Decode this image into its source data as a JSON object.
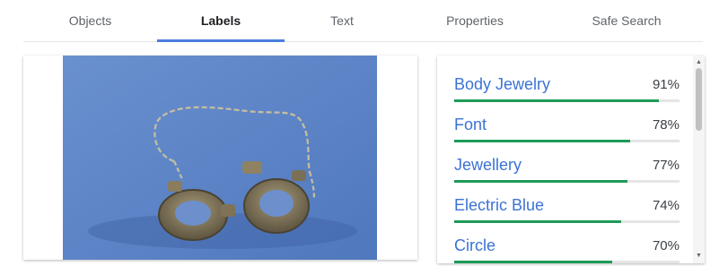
{
  "tabs": [
    {
      "label": "Objects",
      "active": false
    },
    {
      "label": "Labels",
      "active": true
    },
    {
      "label": "Text",
      "active": false
    },
    {
      "label": "Properties",
      "active": false
    },
    {
      "label": "Safe Search",
      "active": false
    }
  ],
  "labels": [
    {
      "name": "Body Jewelry",
      "score": "91%",
      "value": 0.91
    },
    {
      "name": "Font",
      "score": "78%",
      "value": 0.78
    },
    {
      "name": "Jewellery",
      "score": "77%",
      "value": 0.77
    },
    {
      "name": "Electric Blue",
      "score": "74%",
      "value": 0.74
    },
    {
      "name": "Circle",
      "score": "70%",
      "value": 0.7
    }
  ],
  "colors": {
    "tab_indicator": "#4a7fe0",
    "label_text": "#3b73d4",
    "score_bar": "#1e9b58",
    "photo_background": "#5e86c8"
  }
}
